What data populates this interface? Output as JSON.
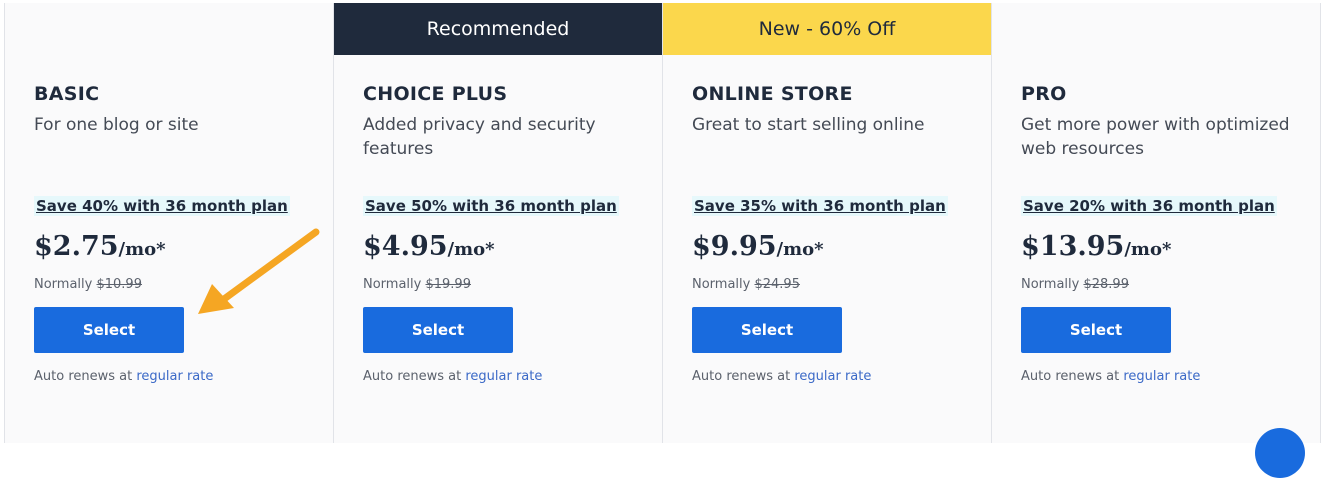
{
  "plans": [
    {
      "banner": "",
      "name": "BASIC",
      "desc": "For one blog or site",
      "save": "Save 40% with 36 month plan",
      "price": "$2.75",
      "per": "/mo*",
      "normally_label": "Normally",
      "normal_price": "$10.99",
      "button": "Select",
      "renew_text": "Auto renews at",
      "renew_link": "regular rate"
    },
    {
      "banner": "Recommended",
      "name": "CHOICE PLUS",
      "desc": "Added privacy and security features",
      "save": "Save 50% with 36 month plan",
      "price": "$4.95",
      "per": "/mo*",
      "normally_label": "Normally",
      "normal_price": "$19.99",
      "button": "Select",
      "renew_text": "Auto renews at",
      "renew_link": "regular rate"
    },
    {
      "banner": "New - 60% Off",
      "name": "ONLINE STORE",
      "desc": "Great to start selling online",
      "save": "Save 35% with 36 month plan",
      "price": "$9.95",
      "per": "/mo*",
      "normally_label": "Normally",
      "normal_price": "$24.95",
      "button": "Select",
      "renew_text": "Auto renews at",
      "renew_link": "regular rate"
    },
    {
      "banner": "",
      "name": "PRO",
      "desc": "Get more power with optimized web resources",
      "save": "Save 20% with 36 month plan",
      "price": "$13.95",
      "per": "/mo*",
      "normally_label": "Normally",
      "normal_price": "$28.99",
      "button": "Select",
      "renew_text": "Auto renews at",
      "renew_link": "regular rate"
    }
  ],
  "colors": {
    "select_button": "#196bde",
    "recommended_banner": "#1f2a3c",
    "sale_banner": "#fbd74c",
    "annotation_arrow": "#f5a623"
  },
  "icons": {
    "arrow": "annotation-arrow-icon",
    "chat": "chat-icon"
  }
}
